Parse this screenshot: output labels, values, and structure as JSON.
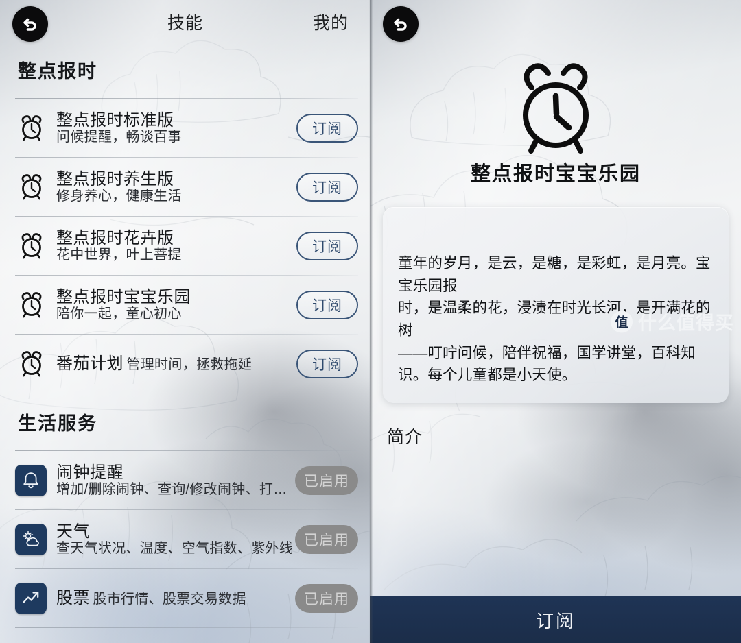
{
  "left": {
    "nav": {
      "back_icon": "back-arrow-icon",
      "title": "技能",
      "right_label": "我的"
    },
    "sections": [
      {
        "heading": "整点报时",
        "items": [
          {
            "icon": "alarm-clock-icon",
            "title": "整点报时标准版",
            "subtitle": "问候提醒，畅谈百事",
            "action": "订阅",
            "action_type": "subscribe"
          },
          {
            "icon": "alarm-clock-icon",
            "title": "整点报时养生版",
            "subtitle": "修身养心，健康生活",
            "action": "订阅",
            "action_type": "subscribe"
          },
          {
            "icon": "alarm-clock-icon",
            "title": "整点报时花卉版",
            "subtitle": "花中世界，叶上菩提",
            "action": "订阅",
            "action_type": "subscribe"
          },
          {
            "icon": "alarm-clock-icon",
            "title": "整点报时宝宝乐园",
            "subtitle": "陪你一起，童心初心",
            "action": "订阅",
            "action_type": "subscribe"
          },
          {
            "icon": "alarm-clock-icon",
            "title": "番茄计划",
            "subtitle": "管理时间，拯救拖延",
            "action": "订阅",
            "action_type": "subscribe"
          }
        ]
      },
      {
        "heading": "生活服务",
        "items": [
          {
            "icon": "bell-icon",
            "title": "闹钟提醒",
            "subtitle": "增加/删除闹钟、查询/修改闹钟、打…",
            "action": "已启用",
            "action_type": "enabled"
          },
          {
            "icon": "weather-icon",
            "title": "天气",
            "subtitle": "查天气状况、温度、空气指数、紫外线",
            "action": "已启用",
            "action_type": "enabled"
          },
          {
            "icon": "stock-chart-icon",
            "title": "股票",
            "subtitle": "股市行情、股票交易数据",
            "action": "已启用",
            "action_type": "enabled"
          }
        ]
      }
    ]
  },
  "right": {
    "nav": {
      "back_icon": "back-arrow-icon"
    },
    "hero": {
      "icon": "alarm-clock-icon",
      "title": "整点报时宝宝乐园"
    },
    "description": "童年的岁月，是云，是糖，是彩虹，是月亮。宝宝乐园报\n时，是温柔的花，浸渍在时光长河，是开满花的树\n——叮咛问候，陪伴祝福，国学讲堂，百科知识。每个儿童都是小天使。",
    "intro_label": "简介",
    "bottom_button": "订阅",
    "watermark": {
      "badge": "值",
      "text": "什么值得买"
    }
  },
  "colors": {
    "accent_navy": "#1e3a5f",
    "bottom_bar": "#1b2d49",
    "subscribe_border": "#3a5578",
    "enabled_pill": "#8a8a8a"
  }
}
